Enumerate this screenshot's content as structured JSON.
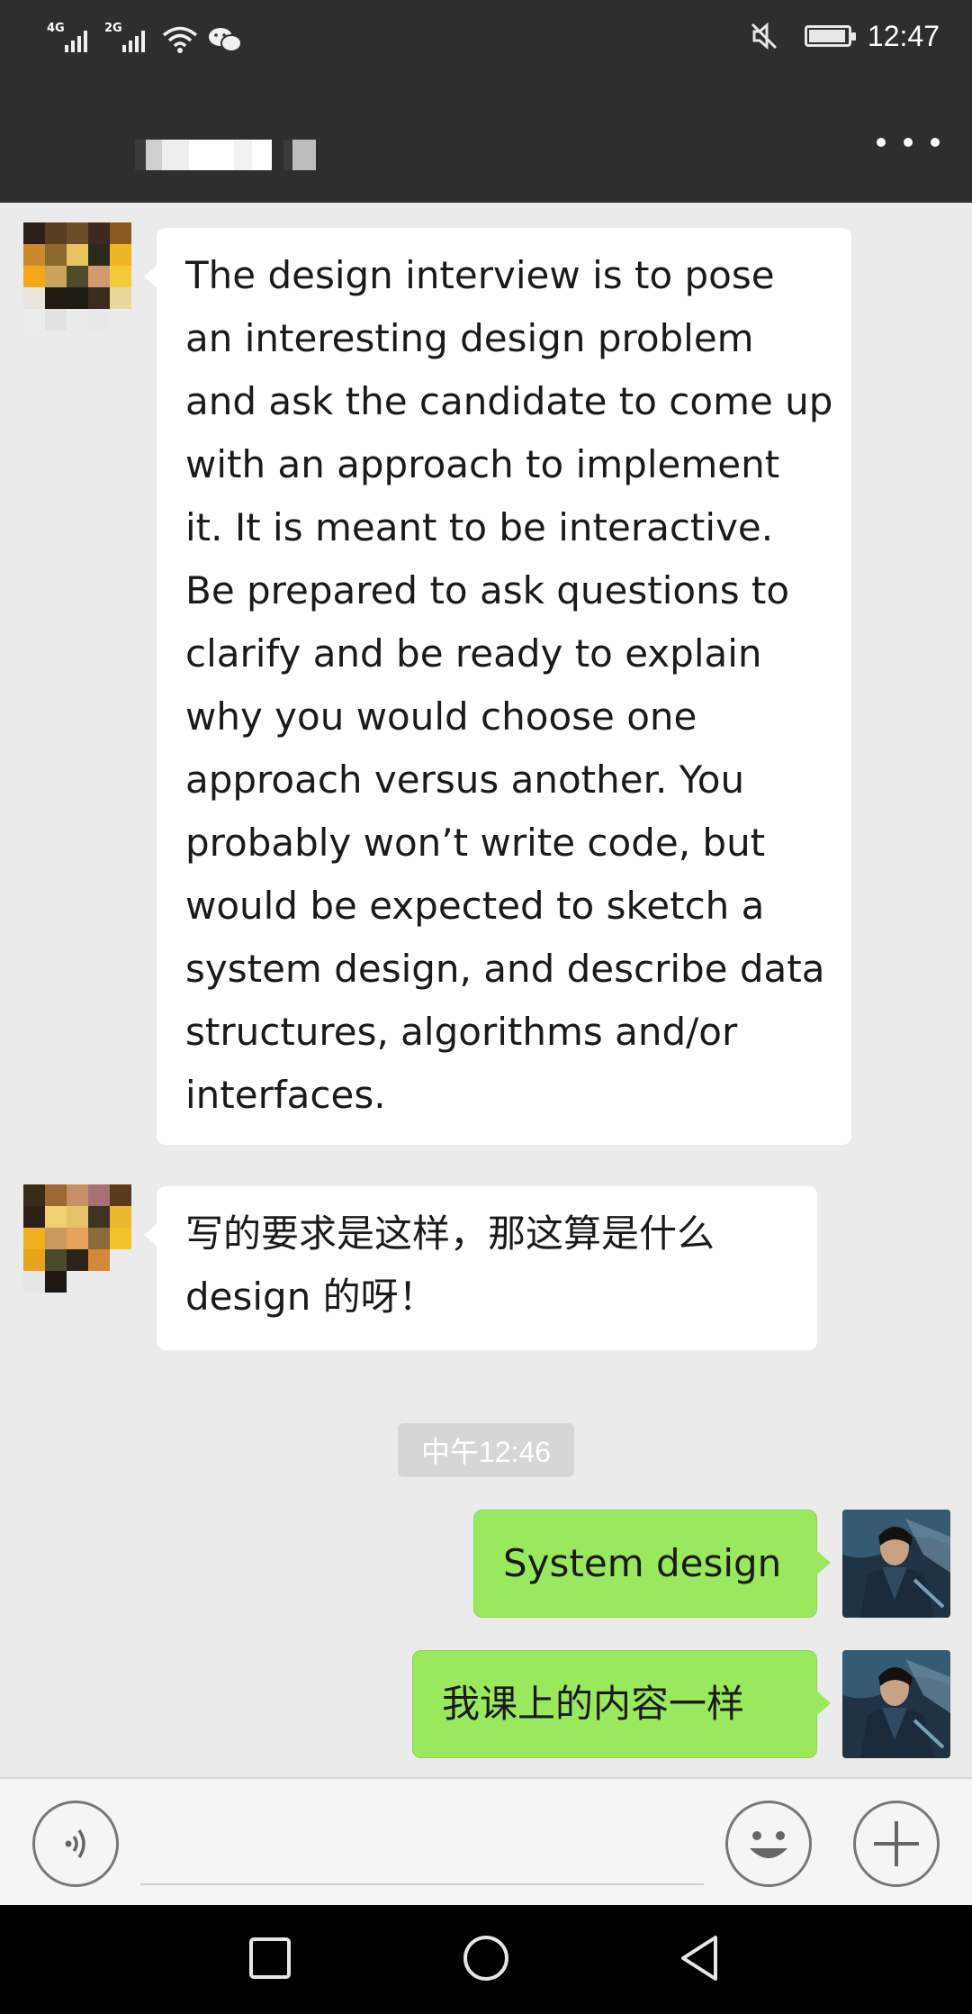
{
  "status_bar": {
    "signal_1_label": "4G",
    "signal_2_label": "2G",
    "time": "12:47",
    "battery_level": 0.95,
    "icons": [
      "wifi-icon",
      "wechat-icon",
      "mute-icon",
      "battery-icon"
    ]
  },
  "title_bar": {
    "chat_title": "",
    "more_icon": "more-dots-icon"
  },
  "messages": [
    {
      "sender": "contact",
      "text": "The design interview is to pose\nan interesting design problem\nand ask the candidate to come up\nwith an approach to implement\nit.  It is meant to be interactive.\nBe prepared to ask questions to\nclarify and be ready to explain\nwhy you would choose one\napproach versus another.  You\nprobably won’t write code, but\nwould be expected to sketch a\nsystem design, and describe data\nstructures, algorithms and/or\ninterfaces."
    },
    {
      "sender": "contact",
      "text": "写的要求是这样，那这算是什么\ndesign 的呀！"
    },
    {
      "sender": "me",
      "text": "System design"
    },
    {
      "sender": "me",
      "text": "我课上的内容一样"
    }
  ],
  "timestamp": "中午12:46",
  "input_bar": {
    "voice_icon": "voice-icon",
    "emoji_icon": "emoji-icon",
    "plus_icon": "plus-icon"
  },
  "nav_bar": {
    "icons": [
      "recent-apps-icon",
      "home-icon",
      "back-icon"
    ]
  },
  "colors": {
    "header_bg": "#2e2e2e",
    "chat_bg": "#ebebeb",
    "outgoing_bubble": "#9ae85d",
    "incoming_bubble": "#ffffff"
  }
}
